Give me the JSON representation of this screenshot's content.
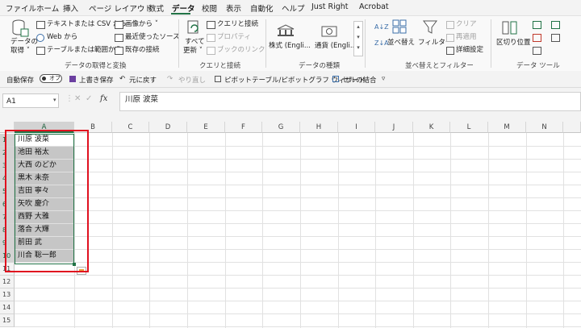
{
  "menu": [
    "ファイル",
    "ホーム",
    "挿入",
    "ページ レイアウト",
    "数式",
    "データ",
    "校閲",
    "表示",
    "自動化",
    "ヘルプ",
    "Just Right",
    "Acrobat"
  ],
  "ribbon": {
    "get_data": {
      "label1": "データの",
      "label2": "取得 ˅"
    },
    "get_group_items": [
      "テキストまたは CSV から",
      "Web から",
      "テーブルまたは範囲から"
    ],
    "get_group_items2": [
      "画像から ˅",
      "最近使ったソース",
      "既存の接続"
    ],
    "group_get": "データの取得と変換",
    "refresh": {
      "label1": "すべて",
      "label2": "更新 ˅"
    },
    "query_items": [
      "クエリと接続",
      "プロパティ",
      "ブックのリンク"
    ],
    "group_query": "クエリと接続",
    "stocks": "株式 (Engli...",
    "currency": "通貨 (Engli...",
    "group_types": "データの種類",
    "sort": "並べ替え",
    "filter": "フィルター",
    "filter_items": [
      "クリア",
      "再適用",
      "詳細設定"
    ],
    "group_sort": "並べ替えとフィルター",
    "text_to_columns": "区切り位置",
    "group_tools": "データ ツール"
  },
  "qat": {
    "autosave": "自動保存",
    "toggle": "オフ",
    "overwrite": "上書き保存",
    "undo": "元に戻す",
    "redo": "やり直し",
    "pivot": "ピボットテーブル/ピボットグラフ ウィザード",
    "merge": "セルの結合"
  },
  "formula_bar": {
    "namebox": "A1",
    "fx": "fx",
    "value": "川原 波菜"
  },
  "columns": [
    "A",
    "B",
    "C",
    "D",
    "E",
    "F",
    "G",
    "H",
    "I",
    "J",
    "K",
    "L",
    "M",
    "N"
  ],
  "rows": [
    "1",
    "2",
    "3",
    "4",
    "5",
    "6",
    "7",
    "8",
    "9",
    "10",
    "11",
    "12",
    "13",
    "14",
    "15"
  ],
  "cells": [
    "川原 波菜",
    "池田 裕太",
    "大西 のどか",
    "黒木 未奈",
    "吉田 寧々",
    "矢吹 慶介",
    "西野 大雅",
    "落合 大輝",
    "前田 武",
    "川合 聡一郎"
  ],
  "colors": {
    "accent": "#217346",
    "highlight_box": "#e0101f"
  }
}
